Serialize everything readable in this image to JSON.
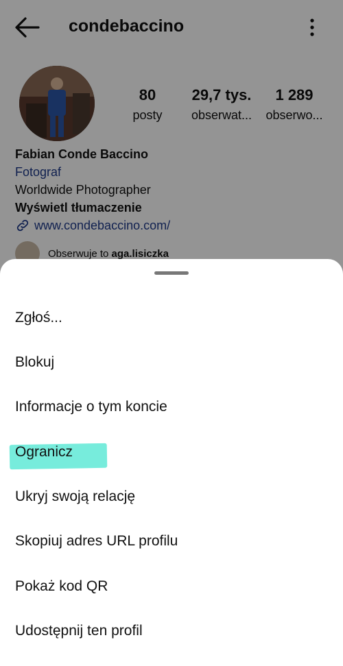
{
  "header": {
    "username": "condebaccino"
  },
  "stats": [
    {
      "value": "80",
      "label": "posty"
    },
    {
      "value": "29,7 tys.",
      "label": "obserwat..."
    },
    {
      "value": "1 289",
      "label": "obserwo..."
    }
  ],
  "bio": {
    "name": "Fabian Conde Baccino",
    "category": "Fotograf",
    "text": "Worldwide Photographer",
    "translate": "Wyświetl tłumaczenie",
    "link": "www.condebaccino.com/"
  },
  "followed_by": {
    "prefix": "Obserwuje to",
    "user": "aga.lisiczka"
  },
  "menu": {
    "items": [
      {
        "label": "Zgłoś..."
      },
      {
        "label": "Blokuj"
      },
      {
        "label": "Informacje o tym koncie"
      },
      {
        "label": "Ogranicz"
      },
      {
        "label": "Ukryj swoją relację"
      },
      {
        "label": "Skopiuj adres URL profilu"
      },
      {
        "label": "Pokaż kod QR"
      },
      {
        "label": "Udostępnij ten profil"
      }
    ]
  },
  "colors": {
    "link": "#1e3a8a",
    "highlight": "#5fe9d6"
  }
}
